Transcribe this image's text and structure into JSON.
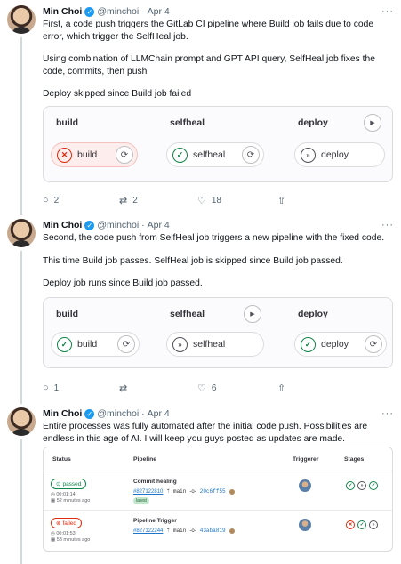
{
  "tweets": [
    {
      "author": "Min Choi",
      "handle": "@minchoi",
      "date": "Apr 4",
      "paragraphs": [
        "First, a code push triggers the GitLab CI pipeline where Build job fails due to code error, which trigger the SelfHeal job.",
        "Using combination of LLMChain prompt and GPT API query, SelfHeal job fixes the code, commits, then push",
        "Deploy skipped since Build job failed"
      ],
      "pipeline": {
        "stages": [
          "build",
          "selfheal",
          "deploy"
        ],
        "jobs": [
          {
            "name": "build",
            "status": "failed"
          },
          {
            "name": "selfheal",
            "status": "passed"
          },
          {
            "name": "deploy",
            "status": "skipped"
          }
        ]
      },
      "stats": {
        "replies": "2",
        "reposts": "2",
        "likes": "18"
      }
    },
    {
      "author": "Min Choi",
      "handle": "@minchoi",
      "date": "Apr 4",
      "paragraphs": [
        "Second, the code push from SelfHeal job triggers a new pipeline with the fixed code.",
        "This time Build job passes. SelfHeal job is skipped since Build job passed.",
        "Deploy job runs since Build job passed."
      ],
      "pipeline": {
        "stages": [
          "build",
          "selfheal",
          "deploy"
        ],
        "jobs": [
          {
            "name": "build",
            "status": "passed"
          },
          {
            "name": "selfheal",
            "status": "skipped"
          },
          {
            "name": "deploy",
            "status": "passed"
          }
        ]
      },
      "stats": {
        "replies": "1",
        "reposts": "",
        "likes": "6"
      }
    },
    {
      "author": "Min Choi",
      "handle": "@minchoi",
      "date": "Apr 4",
      "paragraphs": [
        "Entire processes was fully automated after the initial code push. Possibilities are endless in this age of AI. I will keep you guys posted as updates are made."
      ]
    }
  ],
  "pipelines_table": {
    "headers": [
      "Status",
      "Pipeline",
      "Triggerer",
      "Stages"
    ],
    "rows": [
      {
        "status": "passed",
        "duration": "00:01:14",
        "time_ago": "52 minutes ago",
        "title": "Commit healing",
        "id": "#827122810",
        "branch": "main",
        "sha": "20c6ff55",
        "tag": "latest",
        "stages": [
          "passed",
          "skipped",
          "passed"
        ]
      },
      {
        "status": "failed",
        "duration": "00:01:53",
        "time_ago": "53 minutes ago",
        "title": "Pipeline Trigger",
        "id": "#827122244",
        "branch": "main",
        "sha": "43aba819",
        "tag": "",
        "stages": [
          "failed",
          "passed",
          "skipped"
        ]
      }
    ]
  },
  "colors": {
    "failed": "#dd2b0e",
    "passed": "#108548",
    "skipped": "#535158",
    "link": "#1d9bf0"
  }
}
